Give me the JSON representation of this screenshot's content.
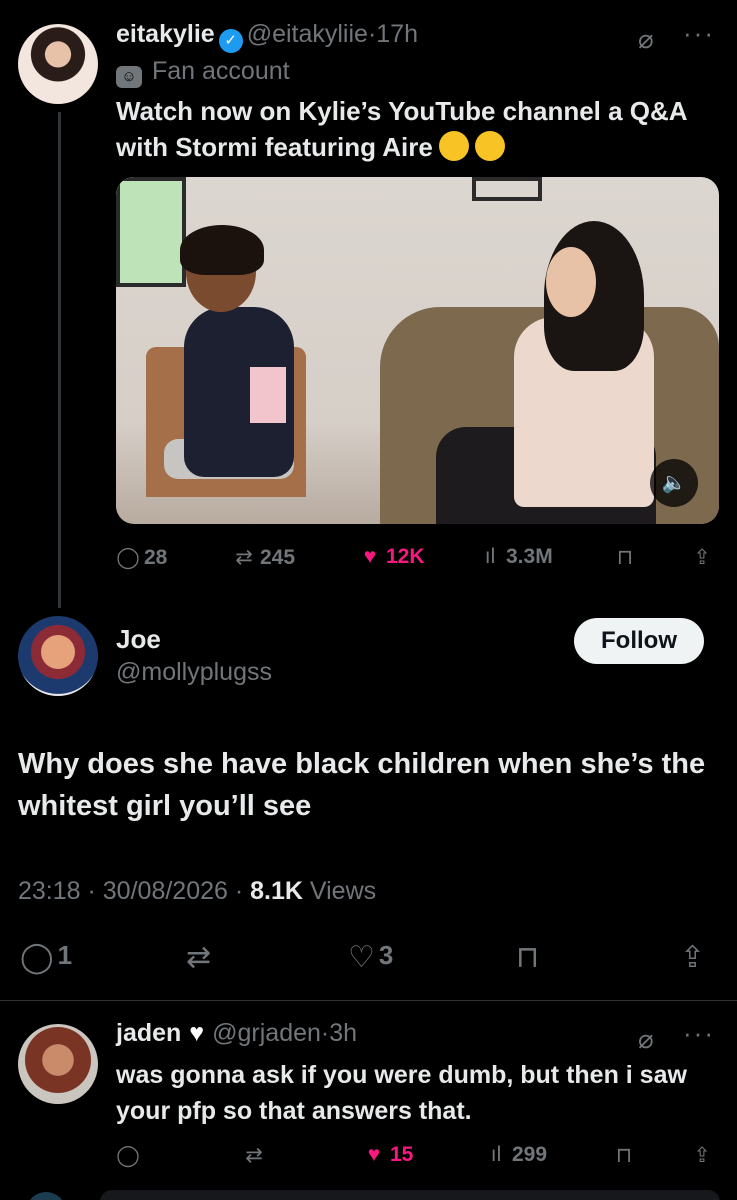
{
  "top_post": {
    "display_name": "eitakylie",
    "handle": "@eitakyliie",
    "separator": "·",
    "time": "17h",
    "label": "Fan account",
    "text": "Watch now on Kylie’s YouTube channel a Q&A with Stormi featuring Aire",
    "stats": {
      "replies": "28",
      "reposts": "245",
      "likes": "12K",
      "views": "3.3M"
    }
  },
  "reply": {
    "display_name": "Joe",
    "handle": "@mollyplugss",
    "follow_label": "Follow",
    "text": "Why does she have black children when she’s the whitest girl you’ll see",
    "time": "23:18",
    "date": "30/08/2026",
    "views_count": "8.1K",
    "views_label": "Views",
    "stats": {
      "replies": "1",
      "likes": "3"
    }
  },
  "sub_reply": {
    "display_name": "jaden",
    "handle": "@grjaden",
    "separator": "·",
    "time": "3h",
    "text": "was gonna ask if you were dumb, but then i saw your pfp so that answers that.",
    "stats": {
      "likes": "15",
      "views": "299"
    }
  },
  "colors": {
    "background": "#000000",
    "text": "#e7e9ea",
    "muted": "#71767b",
    "like": "#f91880",
    "verified": "#1d9bf0"
  }
}
